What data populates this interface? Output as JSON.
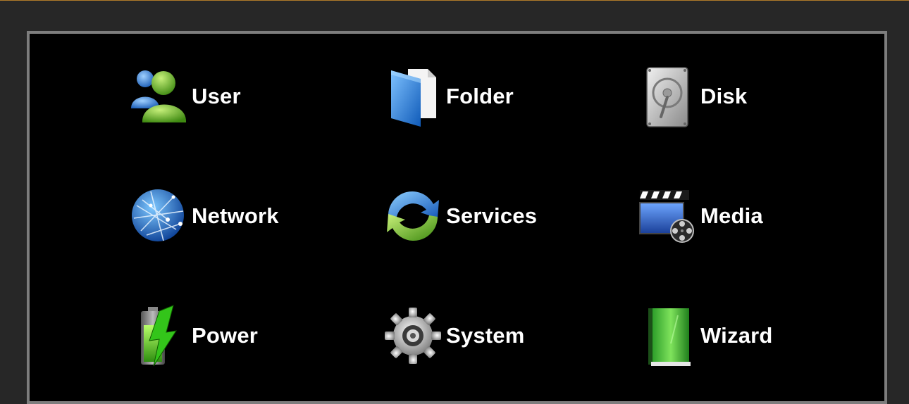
{
  "menu": {
    "items": [
      {
        "label": "User",
        "icon": "users-icon"
      },
      {
        "label": "Folder",
        "icon": "folder-icon"
      },
      {
        "label": "Disk",
        "icon": "disk-icon"
      },
      {
        "label": "Network",
        "icon": "globe-network-icon"
      },
      {
        "label": "Services",
        "icon": "refresh-services-icon"
      },
      {
        "label": "Media",
        "icon": "clapperboard-film-icon"
      },
      {
        "label": "Power",
        "icon": "battery-power-icon"
      },
      {
        "label": "System",
        "icon": "gear-icon"
      },
      {
        "label": "Wizard",
        "icon": "green-book-icon"
      }
    ]
  },
  "colors": {
    "background": "#272727",
    "panel": "#000000",
    "panel_border": "#7d7d7d",
    "accent_line": "#b07a2a",
    "label": "#ffffff"
  }
}
